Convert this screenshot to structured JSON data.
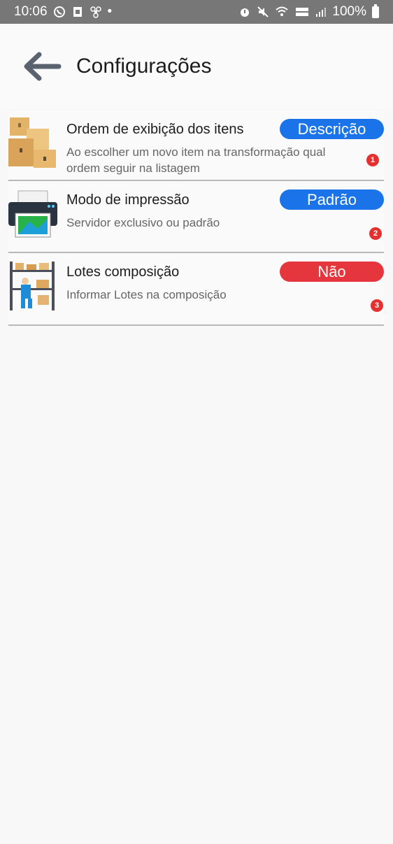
{
  "status_bar": {
    "time": "10:06",
    "battery": "100%",
    "notification_dot": "•",
    "left_icons": [
      "whatsapp-icon",
      "sim-icon",
      "fan-icon"
    ],
    "right_icons": [
      "alarm-icon",
      "mute-icon",
      "wifi-icon",
      "volte-icon",
      "signal-icon",
      "battery-icon"
    ]
  },
  "header": {
    "title": "Configurações",
    "back_icon": "arrow-left-icon"
  },
  "colors": {
    "blue_pill": "#1a73e8",
    "red_pill": "#e5363d",
    "badge": "#e53030",
    "arrow": "#5a6270"
  },
  "settings": [
    {
      "title": "Ordem de exibição dos itens",
      "description": "Ao escolher um novo item na transformação qual ordem seguir na listagem",
      "value": "Descrição",
      "pill_color": "#1a73e8",
      "badge": "1",
      "icon": "boxes-icon"
    },
    {
      "title": "Modo de impressão",
      "description": "Servidor exclusivo ou padrão",
      "value": "Padrão",
      "pill_color": "#1a73e8",
      "badge": "2",
      "icon": "printer-icon"
    },
    {
      "title": "Lotes composição",
      "description": "Informar Lotes na composição",
      "value": "Não",
      "pill_color": "#e5363d",
      "badge": "3",
      "icon": "warehouse-worker-icon"
    }
  ]
}
